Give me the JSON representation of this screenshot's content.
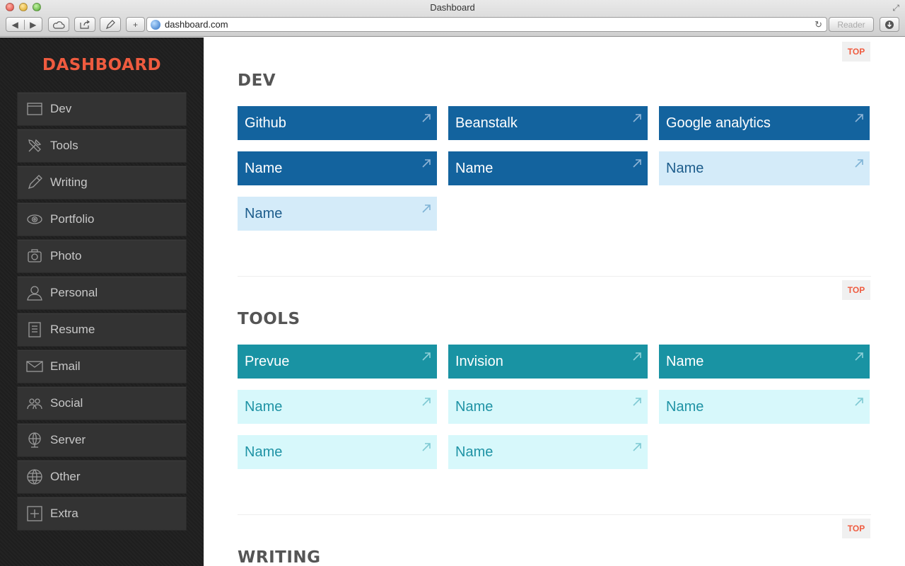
{
  "window": {
    "title": "Dashboard",
    "url": "dashboard.com",
    "reader_label": "Reader"
  },
  "brand": {
    "title": "DASHBOARD",
    "color": "#ef5b3f"
  },
  "sidebar": {
    "items": [
      {
        "label": "Dev",
        "icon": "window-icon"
      },
      {
        "label": "Tools",
        "icon": "tools-icon"
      },
      {
        "label": "Writing",
        "icon": "pencil-icon"
      },
      {
        "label": "Portfolio",
        "icon": "eye-icon"
      },
      {
        "label": "Photo",
        "icon": "camera-icon"
      },
      {
        "label": "Personal",
        "icon": "person-icon"
      },
      {
        "label": "Resume",
        "icon": "document-icon"
      },
      {
        "label": "Email",
        "icon": "envelope-icon"
      },
      {
        "label": "Social",
        "icon": "group-icon"
      },
      {
        "label": "Server",
        "icon": "server-globe-icon"
      },
      {
        "label": "Other",
        "icon": "globe-icon"
      },
      {
        "label": "Extra",
        "icon": "plus-box-icon"
      }
    ]
  },
  "main": {
    "top_label": "TOP",
    "sections": [
      {
        "title": "DEV",
        "tiles": [
          {
            "label": "Github",
            "style": "dark"
          },
          {
            "label": "Beanstalk",
            "style": "dark"
          },
          {
            "label": "Google analytics",
            "style": "dark"
          },
          {
            "label": "Name",
            "style": "dark"
          },
          {
            "label": "Name",
            "style": "dark"
          },
          {
            "label": "Name",
            "style": "light"
          },
          {
            "label": "Name",
            "style": "light"
          }
        ]
      },
      {
        "title": "TOOLS",
        "tiles": [
          {
            "label": "Prevue",
            "style": "dark"
          },
          {
            "label": "Invision",
            "style": "dark"
          },
          {
            "label": "Name",
            "style": "dark"
          },
          {
            "label": "Name",
            "style": "light"
          },
          {
            "label": "Name",
            "style": "light"
          },
          {
            "label": "Name",
            "style": "light"
          },
          {
            "label": "Name",
            "style": "light"
          },
          {
            "label": "Name",
            "style": "light"
          }
        ]
      },
      {
        "title": "WRITING",
        "tiles": []
      }
    ]
  },
  "colors": {
    "dev_dark": "#13639e",
    "dev_light": "#d4ebf9",
    "tools_dark": "#1993a3",
    "tools_light": "#d7f8fb"
  }
}
